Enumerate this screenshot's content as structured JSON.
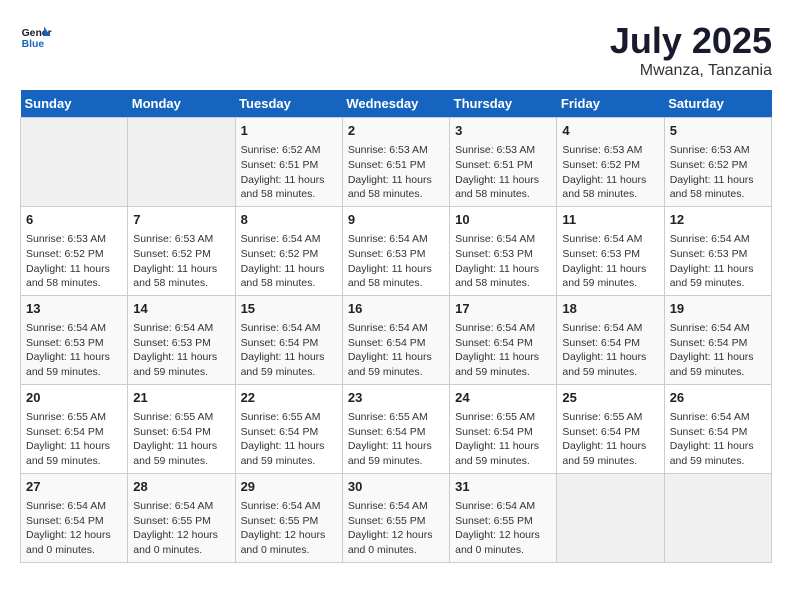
{
  "header": {
    "logo_line1": "General",
    "logo_line2": "Blue",
    "month_year": "July 2025",
    "location": "Mwanza, Tanzania"
  },
  "days_of_week": [
    "Sunday",
    "Monday",
    "Tuesday",
    "Wednesday",
    "Thursday",
    "Friday",
    "Saturday"
  ],
  "weeks": [
    [
      null,
      null,
      {
        "day": 1,
        "sunrise": "6:52 AM",
        "sunset": "6:51 PM",
        "daylight": "11 hours and 58 minutes."
      },
      {
        "day": 2,
        "sunrise": "6:53 AM",
        "sunset": "6:51 PM",
        "daylight": "11 hours and 58 minutes."
      },
      {
        "day": 3,
        "sunrise": "6:53 AM",
        "sunset": "6:51 PM",
        "daylight": "11 hours and 58 minutes."
      },
      {
        "day": 4,
        "sunrise": "6:53 AM",
        "sunset": "6:52 PM",
        "daylight": "11 hours and 58 minutes."
      },
      {
        "day": 5,
        "sunrise": "6:53 AM",
        "sunset": "6:52 PM",
        "daylight": "11 hours and 58 minutes."
      }
    ],
    [
      {
        "day": 6,
        "sunrise": "6:53 AM",
        "sunset": "6:52 PM",
        "daylight": "11 hours and 58 minutes."
      },
      {
        "day": 7,
        "sunrise": "6:53 AM",
        "sunset": "6:52 PM",
        "daylight": "11 hours and 58 minutes."
      },
      {
        "day": 8,
        "sunrise": "6:54 AM",
        "sunset": "6:52 PM",
        "daylight": "11 hours and 58 minutes."
      },
      {
        "day": 9,
        "sunrise": "6:54 AM",
        "sunset": "6:53 PM",
        "daylight": "11 hours and 58 minutes."
      },
      {
        "day": 10,
        "sunrise": "6:54 AM",
        "sunset": "6:53 PM",
        "daylight": "11 hours and 58 minutes."
      },
      {
        "day": 11,
        "sunrise": "6:54 AM",
        "sunset": "6:53 PM",
        "daylight": "11 hours and 59 minutes."
      },
      {
        "day": 12,
        "sunrise": "6:54 AM",
        "sunset": "6:53 PM",
        "daylight": "11 hours and 59 minutes."
      }
    ],
    [
      {
        "day": 13,
        "sunrise": "6:54 AM",
        "sunset": "6:53 PM",
        "daylight": "11 hours and 59 minutes."
      },
      {
        "day": 14,
        "sunrise": "6:54 AM",
        "sunset": "6:53 PM",
        "daylight": "11 hours and 59 minutes."
      },
      {
        "day": 15,
        "sunrise": "6:54 AM",
        "sunset": "6:54 PM",
        "daylight": "11 hours and 59 minutes."
      },
      {
        "day": 16,
        "sunrise": "6:54 AM",
        "sunset": "6:54 PM",
        "daylight": "11 hours and 59 minutes."
      },
      {
        "day": 17,
        "sunrise": "6:54 AM",
        "sunset": "6:54 PM",
        "daylight": "11 hours and 59 minutes."
      },
      {
        "day": 18,
        "sunrise": "6:54 AM",
        "sunset": "6:54 PM",
        "daylight": "11 hours and 59 minutes."
      },
      {
        "day": 19,
        "sunrise": "6:54 AM",
        "sunset": "6:54 PM",
        "daylight": "11 hours and 59 minutes."
      }
    ],
    [
      {
        "day": 20,
        "sunrise": "6:55 AM",
        "sunset": "6:54 PM",
        "daylight": "11 hours and 59 minutes."
      },
      {
        "day": 21,
        "sunrise": "6:55 AM",
        "sunset": "6:54 PM",
        "daylight": "11 hours and 59 minutes."
      },
      {
        "day": 22,
        "sunrise": "6:55 AM",
        "sunset": "6:54 PM",
        "daylight": "11 hours and 59 minutes."
      },
      {
        "day": 23,
        "sunrise": "6:55 AM",
        "sunset": "6:54 PM",
        "daylight": "11 hours and 59 minutes."
      },
      {
        "day": 24,
        "sunrise": "6:55 AM",
        "sunset": "6:54 PM",
        "daylight": "11 hours and 59 minutes."
      },
      {
        "day": 25,
        "sunrise": "6:55 AM",
        "sunset": "6:54 PM",
        "daylight": "11 hours and 59 minutes."
      },
      {
        "day": 26,
        "sunrise": "6:54 AM",
        "sunset": "6:54 PM",
        "daylight": "11 hours and 59 minutes."
      }
    ],
    [
      {
        "day": 27,
        "sunrise": "6:54 AM",
        "sunset": "6:54 PM",
        "daylight": "12 hours and 0 minutes."
      },
      {
        "day": 28,
        "sunrise": "6:54 AM",
        "sunset": "6:55 PM",
        "daylight": "12 hours and 0 minutes."
      },
      {
        "day": 29,
        "sunrise": "6:54 AM",
        "sunset": "6:55 PM",
        "daylight": "12 hours and 0 minutes."
      },
      {
        "day": 30,
        "sunrise": "6:54 AM",
        "sunset": "6:55 PM",
        "daylight": "12 hours and 0 minutes."
      },
      {
        "day": 31,
        "sunrise": "6:54 AM",
        "sunset": "6:55 PM",
        "daylight": "12 hours and 0 minutes."
      },
      null,
      null
    ]
  ]
}
